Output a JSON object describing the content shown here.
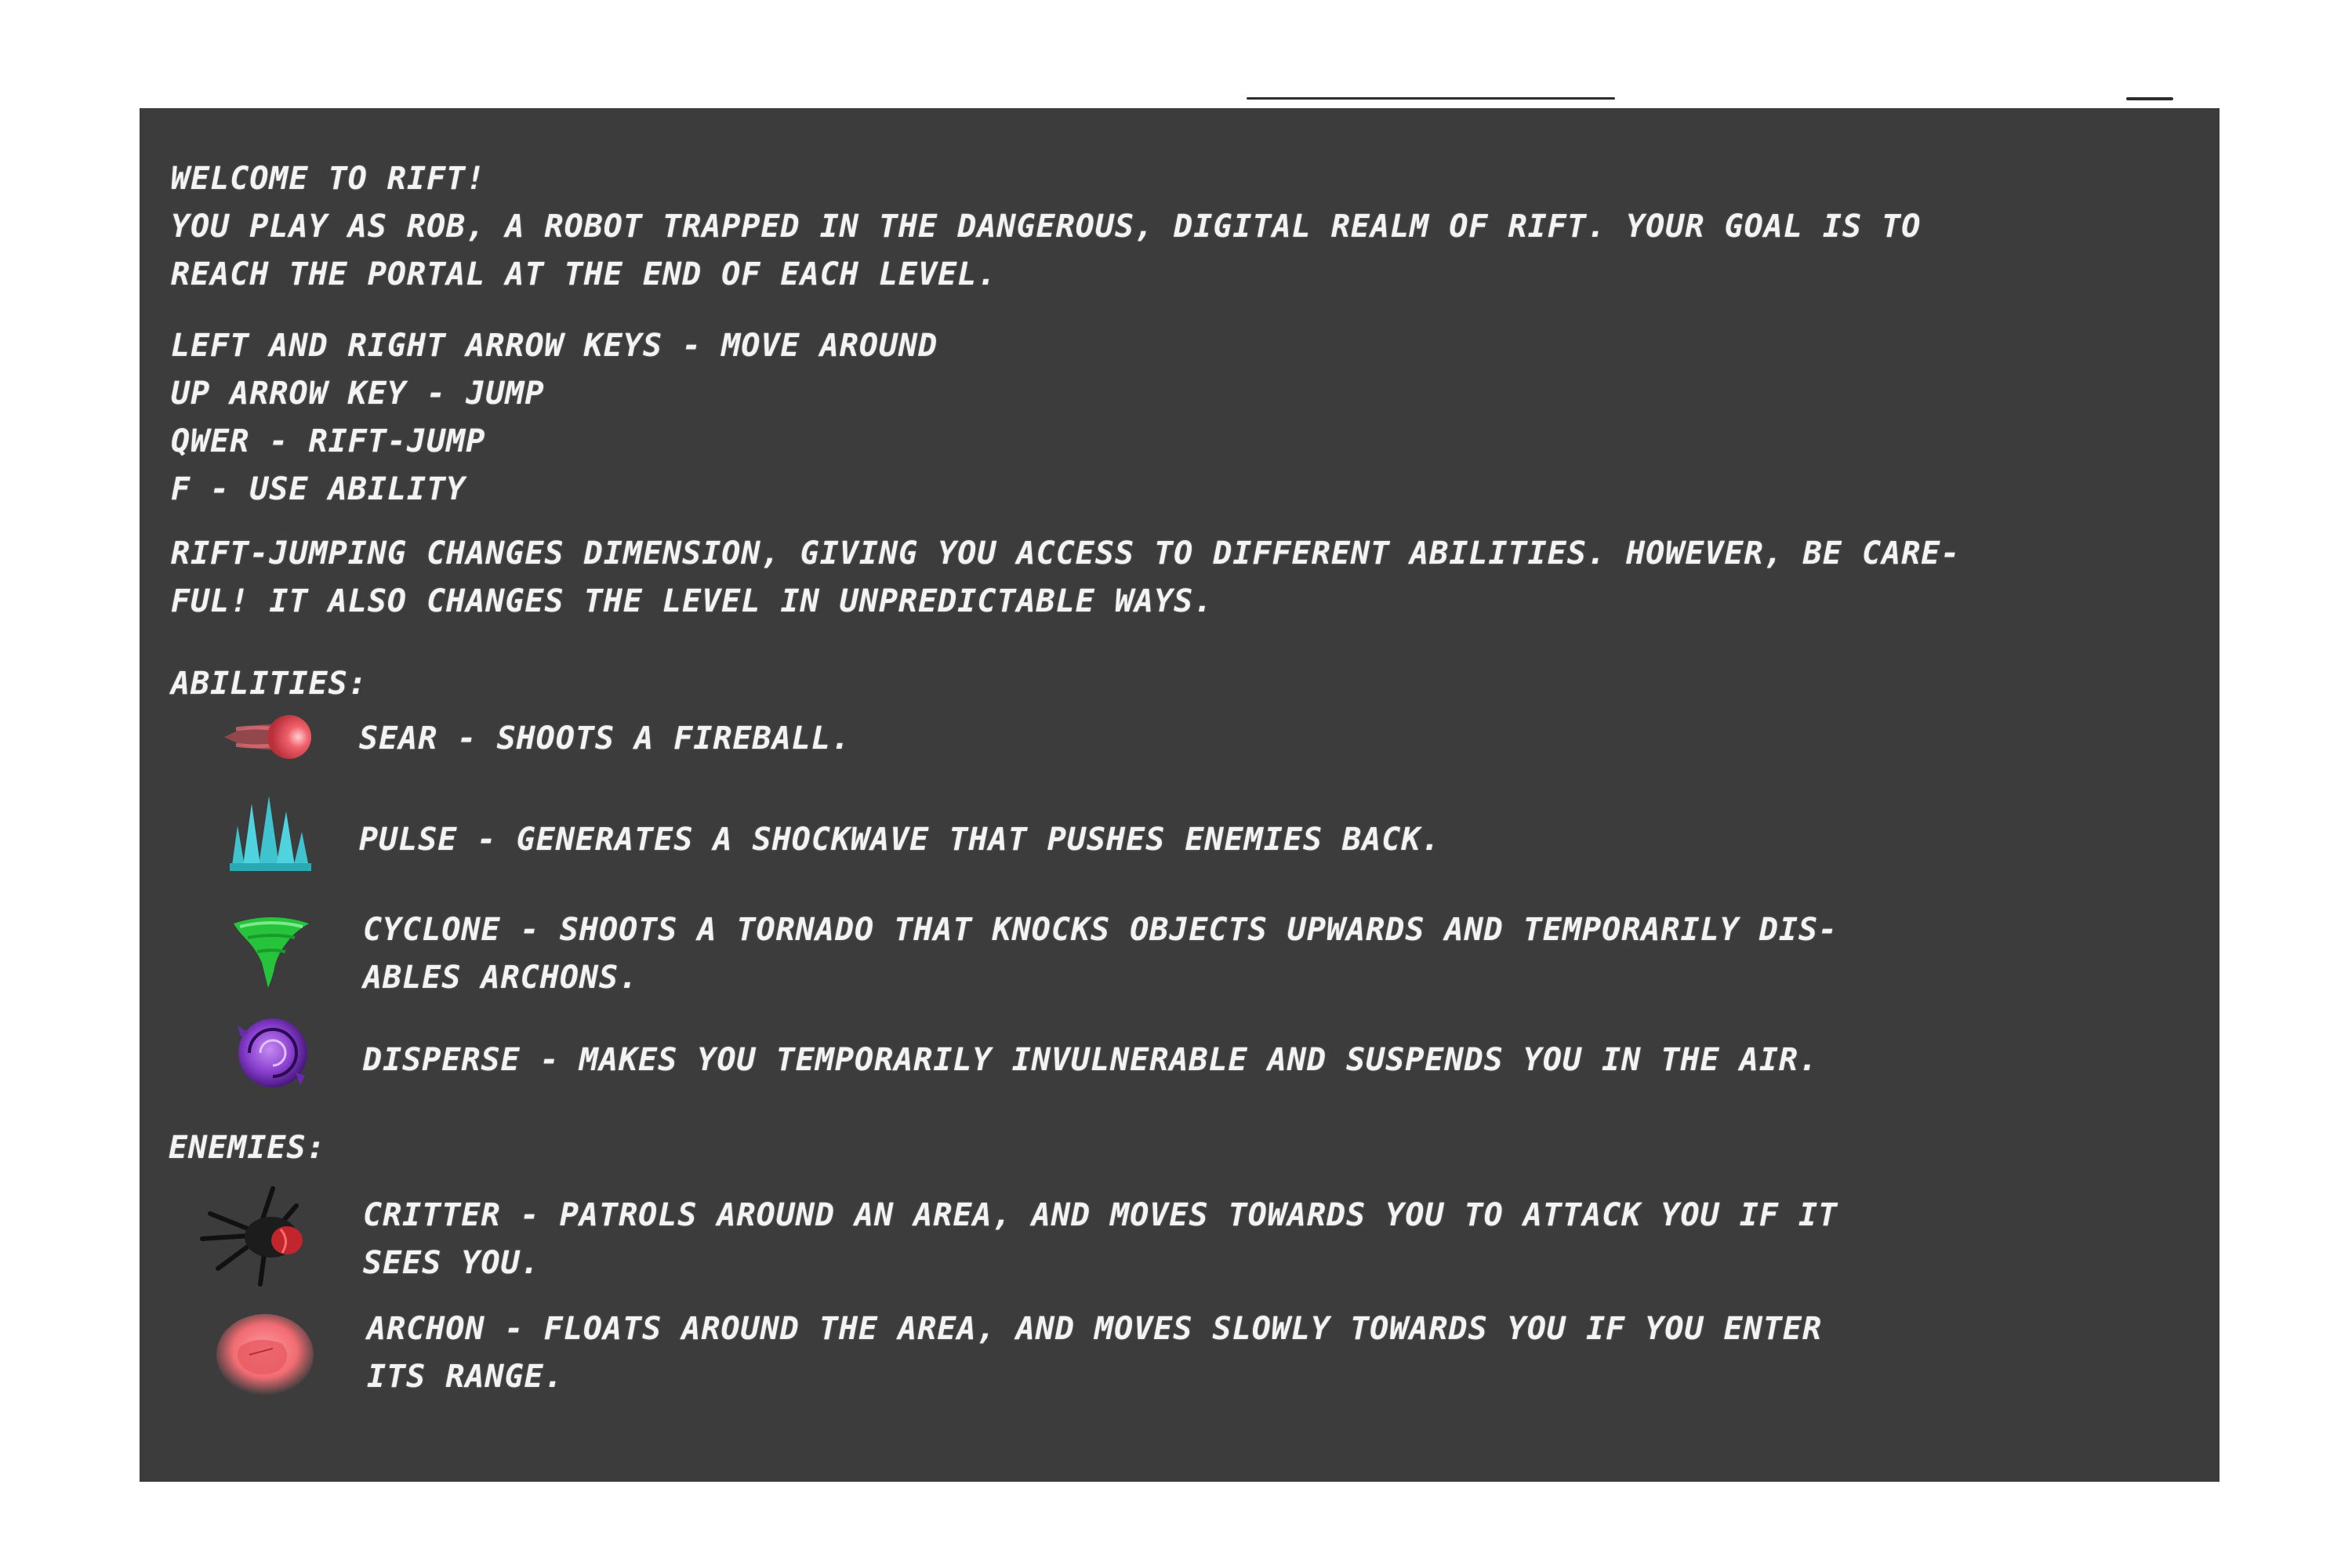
{
  "intro": {
    "welcome": "WELCOME TO RIFT!",
    "description": "YOU PLAY AS ROB, A ROBOT TRAPPED IN THE DANGEROUS, DIGITAL REALM OF RIFT. YOUR GOAL IS TO\nREACH THE PORTAL AT THE END OF EACH LEVEL."
  },
  "controls": [
    "LEFT AND RIGHT ARROW KEYS - MOVE AROUND",
    "UP ARROW KEY - JUMP",
    "QWER - RIFT-JUMP",
    "F - USE ABILITY"
  ],
  "rift_note": "RIFT-JUMPING CHANGES DIMENSION, GIVING YOU ACCESS TO DIFFERENT ABILITIES. HOWEVER, BE CARE-\nFUL! IT ALSO CHANGES THE LEVEL IN UNPREDICTABLE WAYS.",
  "abilities": {
    "heading": "ABILITIES:",
    "items": [
      {
        "icon": "fireball-icon",
        "text": "SEAR - SHOOTS A FIREBALL.",
        "color": "#e2535b"
      },
      {
        "icon": "shockwave-icon",
        "text": "PULSE - GENERATES A SHOCKWAVE THAT PUSHES ENEMIES BACK.",
        "color": "#3ec3cf"
      },
      {
        "icon": "tornado-icon",
        "text": "CYCLONE - SHOOTS A TORNADO THAT KNOCKS OBJECTS UPWARDS AND TEMPORARILY DIS-\nABLES ARCHONS.",
        "color": "#25c43a"
      },
      {
        "icon": "disperse-icon",
        "text": "DISPERSE - MAKES YOU TEMPORARILY INVULNERABLE AND SUSPENDS YOU IN THE AIR.",
        "color": "#8a3fd0"
      }
    ]
  },
  "enemies": {
    "heading": "ENEMIES:",
    "items": [
      {
        "icon": "critter-icon",
        "text": "CRITTER - PATROLS AROUND AN AREA, AND MOVES TOWARDS YOU TO ATTACK YOU IF IT\nSEES YOU.",
        "color": "#c0262c"
      },
      {
        "icon": "archon-icon",
        "text": "ARCHON - FLOATS AROUND THE AREA, AND MOVES SLOWLY TOWARDS YOU IF YOU ENTER\nITS RANGE.",
        "color": "#f06c72"
      }
    ]
  },
  "colors": {
    "panel": "#3c3c3c",
    "text": "#f3f3f3",
    "page": "#ffffff"
  }
}
